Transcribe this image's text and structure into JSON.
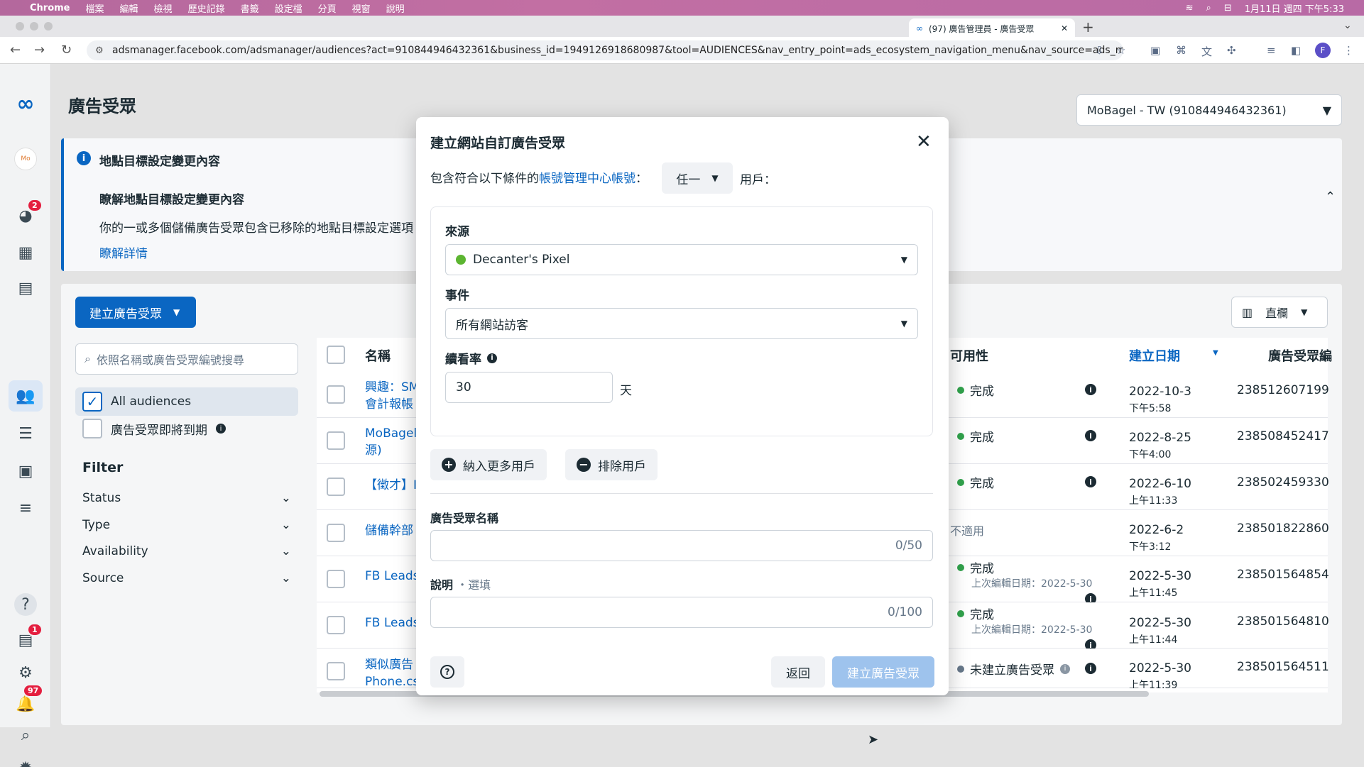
{
  "menubar": {
    "app": "Chrome",
    "items": [
      "檔案",
      "編輯",
      "檢視",
      "歷史記錄",
      "書籤",
      "設定檔",
      "分頁",
      "視窗",
      "說明"
    ],
    "clock": "1月11日 週四 下午5:33"
  },
  "browser": {
    "tab_title": "(97) 廣告管理員 - 廣告受眾",
    "url": "adsmanager.facebook.com/adsmanager/audiences?act=910844946432361&business_id=1949126918680987&tool=AUDIENCES&nav_entry_point=ads_ecosystem_navigation_menu&nav_source=ads_man...",
    "profile_initial": "F"
  },
  "leftnav": {
    "badges": {
      "tools": "2",
      "reports": "1",
      "notifications": "97"
    }
  },
  "page": {
    "title": "廣告受眾",
    "account": "MoBagel - TW (910844946432361)"
  },
  "info_banner": {
    "heading": "地點目標設定變更內容",
    "subheading": "瞭解地點目標設定變更內容",
    "body": "你的一或多個儲備廣告受眾包含已移除的地點目標設定選項",
    "link": "瞭解詳情"
  },
  "sidebar": {
    "create_button": "建立廣告受眾",
    "search_placeholder": "依照名稱或廣告受眾編號搜尋",
    "all_audiences": "All audiences",
    "expiring": "廣告受眾即將到期",
    "filter_heading": "Filter",
    "filters": [
      "Status",
      "Type",
      "Availability",
      "Source"
    ]
  },
  "table": {
    "columns_button": "直欄",
    "headers": {
      "name": "名稱",
      "availability": "可用性",
      "created": "建立日期",
      "audience_id": "廣告受眾編"
    },
    "rows": [
      {
        "name1": "興趣：SM",
        "name2": "會計報帳",
        "status": "完成",
        "sub": "",
        "date": "2022-10-3",
        "time": "下午5:58",
        "id": "238512607199"
      },
      {
        "name1": "MoBagel",
        "name2": "源)",
        "status": "完成",
        "sub": "",
        "date": "2022-8-25",
        "time": "下午4:00",
        "id": "238508452417"
      },
      {
        "name1": "【徵才】I",
        "name2": "",
        "status": "完成",
        "sub": "",
        "date": "2022-6-10",
        "time": "上午11:33",
        "id": "238502459330"
      },
      {
        "name1": "儲備幹部",
        "name2": "",
        "status": "不適用",
        "sub": "",
        "date": "2022-6-2",
        "time": "下午3:12",
        "id": "238501822860"
      },
      {
        "name1": "FB Leads",
        "name2": "",
        "status": "完成",
        "sub": "上次編輯日期：2022-5-30",
        "date": "2022-5-30",
        "time": "上午11:45",
        "id": "238501564854"
      },
      {
        "name1": "FB Leads",
        "name2": "",
        "status": "完成",
        "sub": "上次編輯日期：2022-5-30",
        "date": "2022-5-30",
        "time": "上午11:44",
        "id": "238501564810"
      },
      {
        "name1": "類似廣告",
        "name2": "Phone.cs",
        "status": "未建立廣告受眾",
        "sub": "",
        "date": "2022-5-30",
        "time": "上午11:39",
        "id": "238501564511"
      }
    ]
  },
  "modal": {
    "title": "建立網站自訂廣告受眾",
    "include_prefix": "包含符合以下條件的",
    "include_link": "帳號管理中心帳號",
    "include_colon": "：",
    "any": "任一",
    "users_suffix": "用戶：",
    "source_label": "來源",
    "source_value": "Decanter's Pixel",
    "event_label": "事件",
    "event_value": "所有網站訪客",
    "retention_label": "續看率",
    "retention_value": "30",
    "retention_unit": "天",
    "include_more": "納入更多用戶",
    "exclude": "排除用戶",
    "name_label": "廣告受眾名稱",
    "name_count": "0/50",
    "desc_label": "說明",
    "desc_optional": "・選填",
    "desc_count": "0/100",
    "back": "返回",
    "create": "建立廣告受眾"
  },
  "colors": {
    "accent": "#0a66c2",
    "success": "#31a24c",
    "disabled_button": "#9ec3ed"
  }
}
